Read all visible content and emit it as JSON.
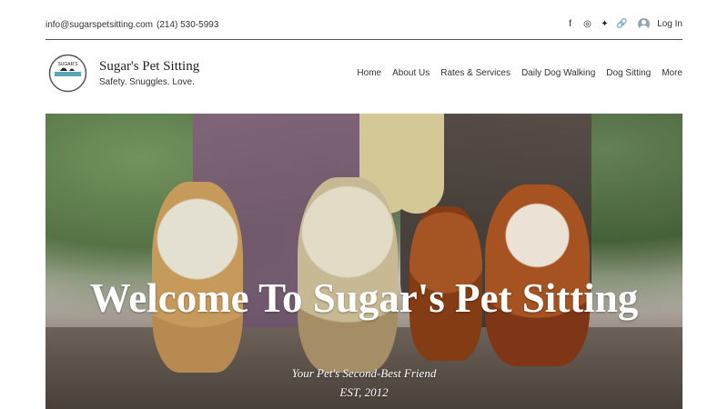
{
  "topbar": {
    "email": "info@sugarspetsitting.com",
    "phone": "(214) 530-5993",
    "social_icons": [
      "facebook-icon",
      "instagram-icon",
      "yelp-icon",
      "link-icon"
    ],
    "login_label": "Log In"
  },
  "header": {
    "logo_text": "SUGAR'S",
    "brand_title": "Sugar's Pet Sitting",
    "tagline": "Safety. Snuggles. Love."
  },
  "nav": {
    "items": [
      "Home",
      "About Us",
      "Rates & Services",
      "Daily Dog Walking",
      "Dog Sitting",
      "More"
    ]
  },
  "hero": {
    "title": "Welcome To Sugar's Pet Sitting",
    "subtitle": "Your Pet's Second-Best Friend",
    "established": "EST, 2012"
  }
}
